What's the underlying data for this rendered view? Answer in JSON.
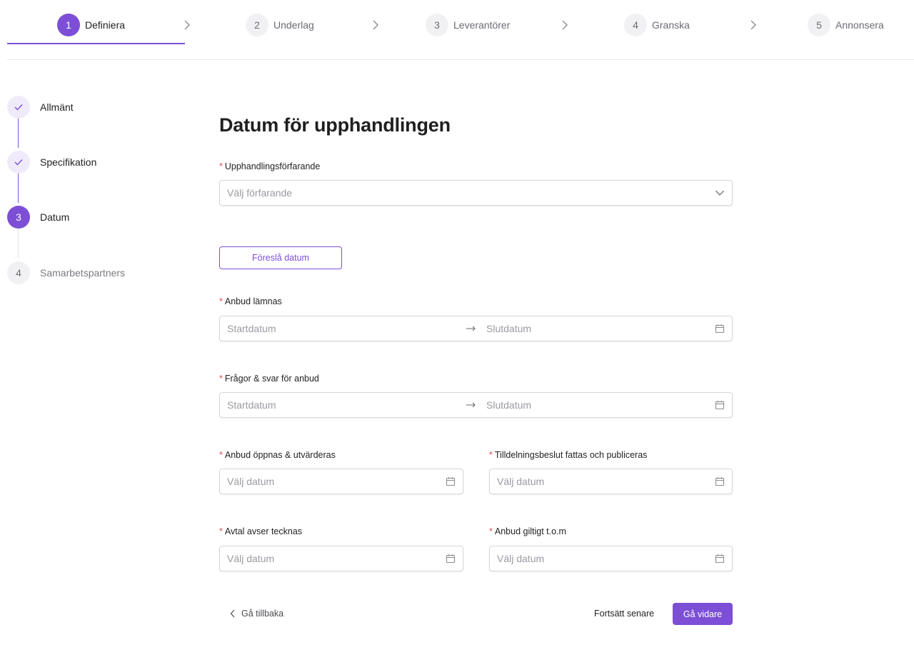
{
  "top_steps": [
    {
      "num": "1",
      "label": "Definiera"
    },
    {
      "num": "2",
      "label": "Underlag"
    },
    {
      "num": "3",
      "label": "Leverantörer"
    },
    {
      "num": "4",
      "label": "Granska"
    },
    {
      "num": "5",
      "label": "Annonsera"
    }
  ],
  "side_steps": [
    {
      "num": "",
      "label": "Allmänt",
      "state": "done"
    },
    {
      "num": "",
      "label": "Specifikation",
      "state": "done"
    },
    {
      "num": "3",
      "label": "Datum",
      "state": "active"
    },
    {
      "num": "4",
      "label": "Samarbetspartners",
      "state": "todo"
    }
  ],
  "page_title": "Datum för upphandlingen",
  "required_mark": "*",
  "procedure": {
    "label": "Upphandlingsförfarande",
    "placeholder": "Välj förfarande"
  },
  "suggest_button": "Föreslå datum",
  "tender_submission": {
    "label": "Anbud lämnas",
    "start_placeholder": "Startdatum",
    "end_placeholder": "Slutdatum"
  },
  "questions": {
    "label": "Frågor & svar för anbud",
    "start_placeholder": "Startdatum",
    "end_placeholder": "Slutdatum"
  },
  "opening": {
    "label": "Anbud öppnas & utvärderas",
    "placeholder": "Välj datum"
  },
  "award": {
    "label": "Tilldelningsbeslut fattas och publiceras",
    "placeholder": "Välj datum"
  },
  "contract": {
    "label": "Avtal avser tecknas",
    "placeholder": "Välj datum"
  },
  "valid_until": {
    "label": "Anbud giltigt t.o.m",
    "placeholder": "Välj datum"
  },
  "footer": {
    "back": "Gå tillbaka",
    "later": "Fortsätt senare",
    "next": "Gå vidare"
  },
  "colors": {
    "accent": "#7c4fd6",
    "required": "#e5484d"
  }
}
